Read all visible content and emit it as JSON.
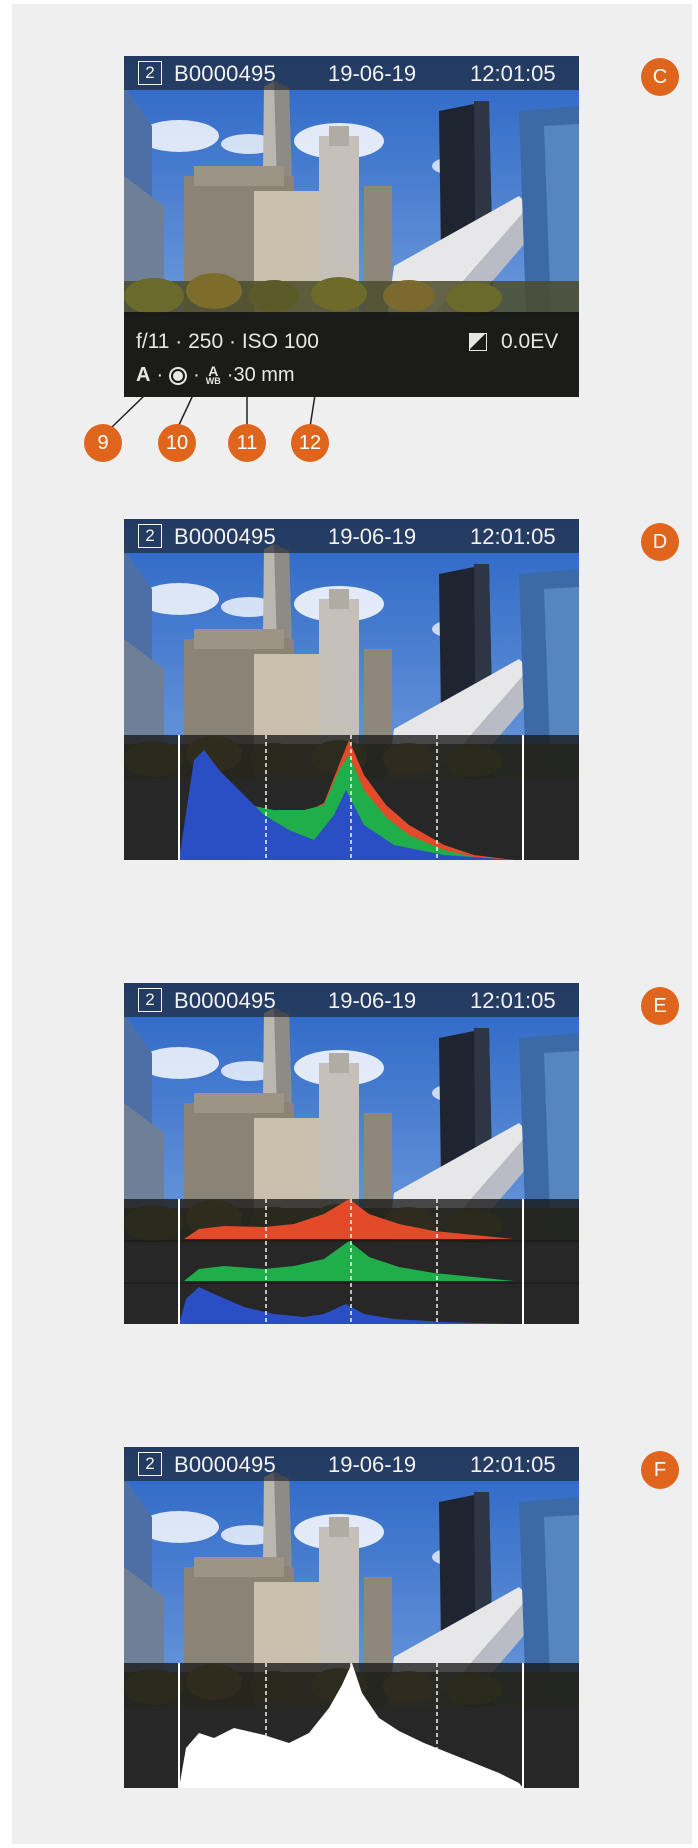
{
  "screens": [
    {
      "topbar": {
        "card": "2",
        "frame": "B0000495",
        "date": "19-06-19",
        "time": "12:01:05"
      },
      "badge": "C",
      "info": {
        "exposure": "f/11 · 250 · ISO 100",
        "ev": "0.0EV",
        "mode": "A",
        "sep1": "·",
        "sep2": "·",
        "wb_a": "A",
        "wb_label": "WB",
        "focal": "·30 mm"
      },
      "callouts": [
        "9",
        "10",
        "11",
        "12"
      ]
    },
    {
      "topbar": {
        "card": "2",
        "frame": "B0000495",
        "date": "19-06-19",
        "time": "12:01:05"
      },
      "badge": "D",
      "histogram": "rgb-overlay"
    },
    {
      "topbar": {
        "card": "2",
        "frame": "B0000495",
        "date": "19-06-19",
        "time": "12:01:05"
      },
      "badge": "E",
      "histogram": "rgb-separate"
    },
    {
      "topbar": {
        "card": "2",
        "frame": "B0000495",
        "date": "19-06-19",
        "time": "12:01:05"
      },
      "badge": "F",
      "histogram": "luminance"
    }
  ],
  "colors": {
    "accent": "#e0651c",
    "red": "#e24a2a",
    "green": "#1fae4a",
    "blue": "#2a4ec4",
    "white": "#ffffff"
  }
}
